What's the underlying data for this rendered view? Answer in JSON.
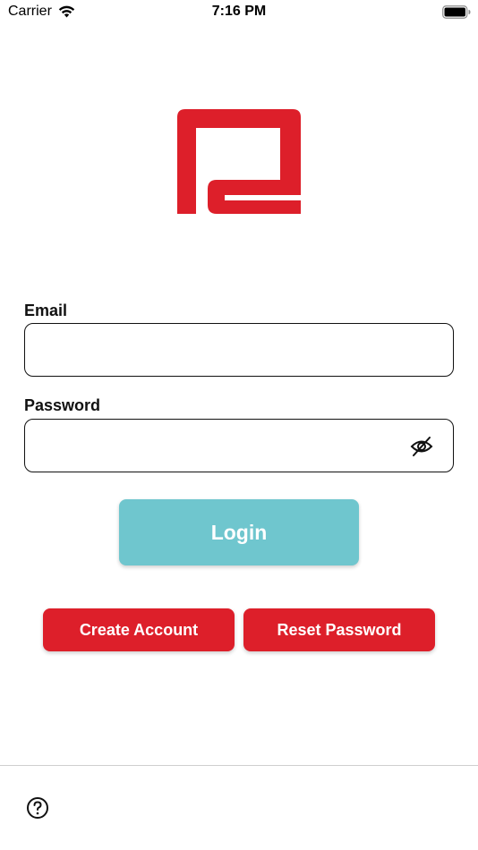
{
  "status_bar": {
    "carrier": "Carrier",
    "time": "7:16 PM"
  },
  "colors": {
    "brand_red": "#dd1f2a",
    "login_teal": "#6fc6ce"
  },
  "form": {
    "email_label": "Email",
    "email_value": "",
    "email_placeholder": "",
    "password_label": "Password",
    "password_value": "",
    "password_placeholder": ""
  },
  "buttons": {
    "login": "Login",
    "create_account": "Create Account",
    "reset_password": "Reset Password"
  },
  "icons": {
    "wifi": "wifi-icon",
    "battery": "battery-icon",
    "logo": "logo-icon",
    "password_toggle": "eye-off-icon",
    "help": "help-icon"
  }
}
